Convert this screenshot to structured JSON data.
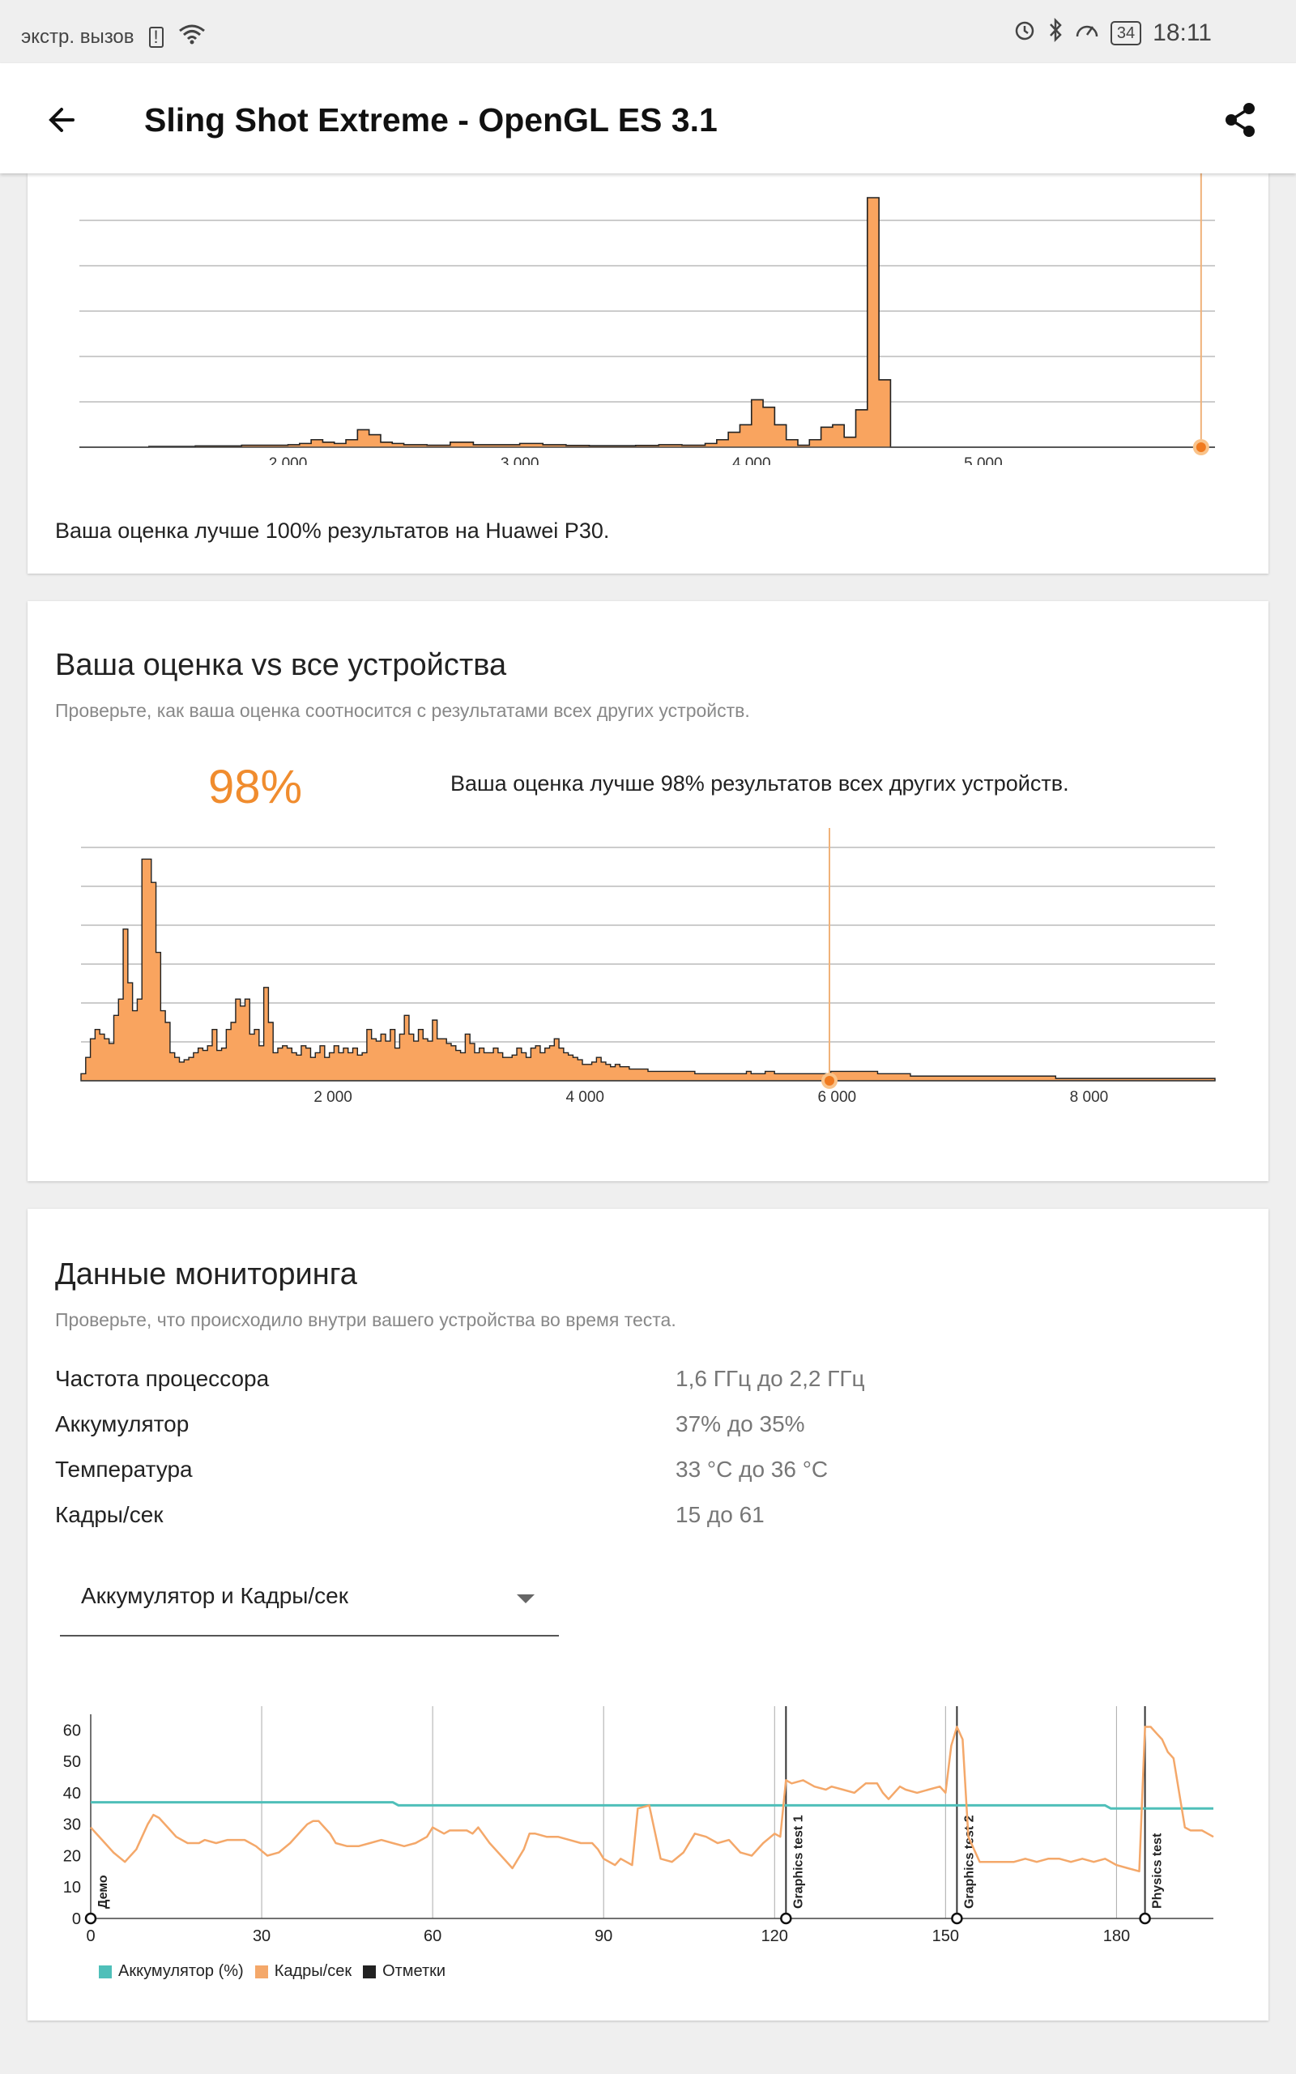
{
  "status_bar": {
    "carrier": "экстр. вызов",
    "battery": "34",
    "time": "18:11"
  },
  "app_bar": {
    "title": "Sling Shot Extreme - OpenGL ES 3.1"
  },
  "device_card": {
    "summary": "Ваша оценка лучше 100% результатов на Huawei P30."
  },
  "all_devices_card": {
    "title": "Ваша оценка vs все устройства",
    "subtitle": "Проверьте, как ваша оценка соотносится с результатами всех других устройств.",
    "percent": "98%",
    "summary": "Ваша оценка лучше 98% результатов всех других устройств."
  },
  "monitoring_card": {
    "title": "Данные мониторинга",
    "subtitle": "Проверьте, что происходило внутри вашего устройства во время теста.",
    "rows": [
      {
        "label": "Частота процессора",
        "value": "1,6 ГГц до 2,2 ГГц"
      },
      {
        "label": "Аккумулятор",
        "value": "37% до 35%"
      },
      {
        "label": "Температура",
        "value": "33 °C до 36 °C"
      },
      {
        "label": "Кадры/сек",
        "value": "15 до 61"
      }
    ],
    "dropdown_value": "Аккумулятор и Кадры/сек",
    "legend": [
      {
        "label": "Аккумулятор (%)",
        "color": "#4fbfb9"
      },
      {
        "label": "Кадры/сек",
        "color": "#f4a86a"
      },
      {
        "label": "Отметки",
        "color": "#222222"
      }
    ]
  },
  "colors": {
    "accent": "#f08c2e",
    "bar_fill": "#f9a45f",
    "battery_line": "#4fbfb9",
    "fps_line": "#f4a86a"
  },
  "chart_data": [
    {
      "type": "bar",
      "x_ticks": [
        "2 000",
        "3 000",
        "4 000",
        "5 000"
      ],
      "xlim": [
        1100,
        6000
      ],
      "your_score": 5940,
      "bins_x": [
        1100,
        1200,
        1300,
        1400,
        1500,
        1600,
        1700,
        1800,
        1900,
        2000,
        2050,
        2100,
        2150,
        2200,
        2250,
        2300,
        2350,
        2400,
        2450,
        2500,
        2600,
        2700,
        2800,
        2900,
        3000,
        3100,
        3200,
        3300,
        3400,
        3500,
        3600,
        3700,
        3800,
        3850,
        3900,
        3950,
        4000,
        4050,
        4100,
        4150,
        4200,
        4250,
        4300,
        4350,
        4400,
        4450,
        4500,
        4550,
        4600,
        4650,
        4700
      ],
      "values": [
        0,
        0,
        0,
        0.3,
        0.3,
        0.5,
        0.5,
        0.8,
        0.8,
        1,
        1.5,
        3,
        2,
        1.5,
        3,
        7,
        5,
        2,
        1.5,
        1,
        0.8,
        2,
        1,
        1,
        1.5,
        1,
        0.7,
        0.6,
        0.6,
        0.7,
        1,
        0.8,
        1.5,
        3,
        6,
        9,
        19,
        16,
        9,
        3,
        0.8,
        3,
        8,
        9,
        4,
        15,
        100,
        27,
        0,
        0,
        0
      ]
    },
    {
      "type": "bar",
      "x_ticks": [
        "2 000",
        "4 000",
        "6 000",
        "8 000"
      ],
      "xlim": [
        0,
        9000
      ],
      "your_score": 5940,
      "values": [
        3,
        10,
        18,
        22,
        20,
        18,
        16,
        28,
        35,
        65,
        42,
        30,
        35,
        95,
        95,
        85,
        55,
        30,
        25,
        12,
        10,
        8,
        9,
        10,
        12,
        14,
        13,
        15,
        22,
        13,
        14,
        22,
        25,
        35,
        32,
        35,
        20,
        22,
        15,
        40,
        25,
        12,
        14,
        15,
        14,
        12,
        11,
        15,
        14,
        10,
        12,
        15,
        10,
        12,
        15,
        12,
        14,
        12,
        14,
        11,
        12,
        22,
        18,
        17,
        20,
        17,
        22,
        14,
        20,
        28,
        20,
        17,
        22,
        18,
        17,
        26,
        18,
        18,
        16,
        15,
        13,
        12,
        20,
        16,
        12,
        14,
        12,
        12,
        14,
        12,
        10,
        10,
        11,
        14,
        12,
        10,
        14,
        15,
        12,
        14,
        15,
        18,
        14,
        12,
        11,
        10,
        9,
        7,
        7,
        8,
        10,
        8,
        7,
        6,
        7,
        6,
        6,
        5,
        5,
        5,
        5,
        4,
        4,
        4,
        4,
        4,
        4,
        4,
        4,
        4,
        4,
        3,
        3,
        3,
        3,
        3,
        3,
        3,
        3,
        3,
        3,
        3,
        4,
        3,
        3,
        3,
        4,
        4,
        3,
        3,
        3,
        3,
        3,
        3,
        3,
        3,
        3,
        3,
        3,
        3,
        4,
        4,
        4,
        4,
        4,
        4,
        4,
        4,
        4,
        4,
        3,
        3,
        3,
        3,
        3,
        3,
        3,
        2,
        2,
        2,
        2,
        2,
        2,
        2,
        2,
        2,
        2,
        2,
        2,
        2,
        2,
        2,
        2,
        2,
        2,
        2,
        2,
        2,
        2,
        2,
        2,
        2,
        2,
        2,
        2,
        2,
        2,
        2,
        1,
        1,
        1,
        1,
        1,
        1,
        1,
        1,
        1,
        1,
        1,
        1,
        1,
        1,
        1,
        1,
        1,
        1,
        1,
        1,
        1,
        1,
        1,
        1,
        1,
        1,
        1,
        1,
        1,
        1,
        1,
        1,
        1,
        1
      ]
    },
    {
      "type": "line",
      "x_ticks": [
        0,
        30,
        60,
        90,
        120,
        150,
        180
      ],
      "y_ticks": [
        0,
        10,
        20,
        30,
        40,
        50,
        60
      ],
      "xlim": [
        0,
        197
      ],
      "ylim": [
        0,
        65
      ],
      "markers": [
        {
          "x": 0,
          "label": "Демо"
        },
        {
          "x": 122,
          "label": "Graphics test 1"
        },
        {
          "x": 152,
          "label": "Graphics test 2"
        },
        {
          "x": 185,
          "label": "Physics test"
        }
      ],
      "series": [
        {
          "name": "Аккумулятор (%)",
          "x": [
            0,
            53,
            54,
            178,
            179,
            197
          ],
          "y": [
            37,
            37,
            36,
            36,
            35,
            35
          ]
        },
        {
          "name": "Кадры/сек",
          "x": [
            0,
            2,
            4,
            6,
            8,
            10,
            11,
            12,
            14,
            15,
            17,
            19,
            20,
            22,
            24,
            26,
            27,
            29,
            31,
            33,
            35,
            37,
            38,
            39,
            40,
            41,
            42,
            43,
            45,
            47,
            49,
            51,
            53,
            55,
            57,
            59,
            60,
            62,
            63,
            64,
            66,
            67,
            68,
            70,
            72,
            74,
            76,
            77,
            78,
            80,
            82,
            84,
            86,
            88,
            89,
            90,
            92,
            93,
            94,
            95,
            96,
            98,
            100,
            102,
            104,
            106,
            108,
            110,
            112,
            114,
            116,
            118,
            120,
            121,
            122,
            123,
            125,
            127,
            129,
            130,
            132,
            134,
            136,
            138,
            139,
            140,
            141,
            142,
            143,
            145,
            147,
            149,
            150,
            151,
            152,
            153,
            154,
            156,
            158,
            160,
            162,
            164,
            166,
            168,
            170,
            172,
            174,
            176,
            178,
            180,
            182,
            184,
            185,
            186,
            187,
            188,
            189,
            190,
            191,
            192,
            193,
            194,
            195,
            196,
            197
          ],
          "y": [
            29,
            25,
            21,
            18,
            22,
            30,
            33,
            32,
            28,
            26,
            24,
            24,
            25,
            24,
            25,
            25,
            25,
            23,
            20,
            21,
            24,
            28,
            30,
            31,
            31,
            29,
            27,
            24,
            23,
            23,
            24,
            25,
            24,
            23,
            24,
            26,
            29,
            27,
            28,
            28,
            28,
            27,
            29,
            24,
            20,
            16,
            22,
            27,
            27,
            26,
            26,
            25,
            24,
            24,
            22,
            19,
            17,
            19,
            18,
            17,
            35,
            36,
            19,
            18,
            21,
            27,
            26,
            24,
            25,
            21,
            20,
            24,
            27,
            26,
            44,
            43,
            44,
            42,
            41,
            42,
            41,
            40,
            43,
            43,
            40,
            38,
            40,
            42,
            41,
            40,
            41,
            42,
            40,
            55,
            61,
            57,
            26,
            18,
            18,
            18,
            18,
            19,
            18,
            19,
            19,
            18,
            19,
            18,
            19,
            17,
            16,
            15,
            61,
            61,
            59,
            57,
            53,
            51,
            40,
            29,
            28,
            28,
            28,
            27,
            26
          ]
        }
      ]
    }
  ]
}
